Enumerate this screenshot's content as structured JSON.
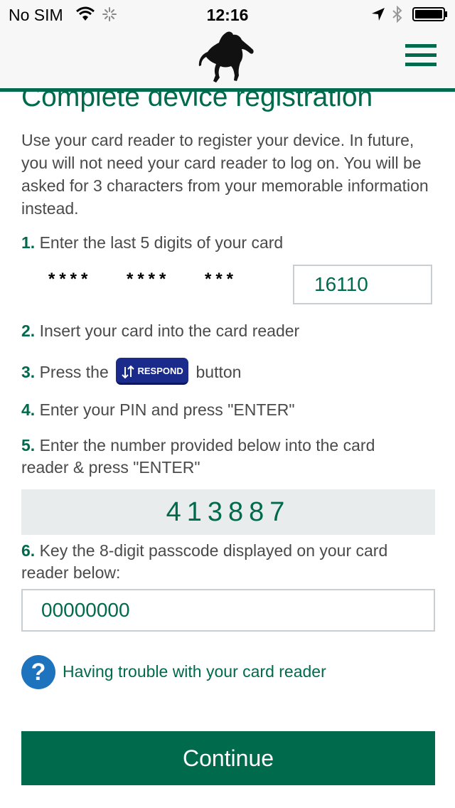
{
  "status_bar": {
    "carrier": "No SIM",
    "time": "12:16"
  },
  "header": {
    "logo_icon": "horse-logo-icon",
    "menu_icon": "hamburger-menu-icon"
  },
  "page": {
    "title": "Complete device registration",
    "intro": "Use your card reader to register your device. In future, you will not need your card reader to log on. You will be asked for 3 characters from your memorable information instead."
  },
  "steps": {
    "s1": {
      "num": "1.",
      "text": "Enter the last 5 digits of your card"
    },
    "s2": {
      "num": "2.",
      "text": "Insert your card into the card reader"
    },
    "s3": {
      "num": "3.",
      "text_before": "Press the",
      "text_after": "button"
    },
    "s4": {
      "num": "4.",
      "text": "Enter your PIN and press \"ENTER\""
    },
    "s5": {
      "num": "5.",
      "text": "Enter the number provided below into the card reader & press \"ENTER\""
    },
    "s6": {
      "num": "6.",
      "text": "Key the 8-digit passcode displayed on your card reader below:"
    }
  },
  "card": {
    "mask_1": "****",
    "mask_2": "****",
    "mask_3": "***",
    "last_digits_value": "16110"
  },
  "respond_button": {
    "label": "RESPOND",
    "icon": "up-down-arrows-icon",
    "color": "#1b2b8c"
  },
  "challenge_code": "413887",
  "passcode": {
    "value": "00000000"
  },
  "help": {
    "icon": "question-icon",
    "label": "Having trouble with your card reader"
  },
  "continue_label": "Continue",
  "colors": {
    "brand_green": "#006a4d",
    "help_blue": "#1e73be",
    "code_bg": "#e8eced"
  }
}
